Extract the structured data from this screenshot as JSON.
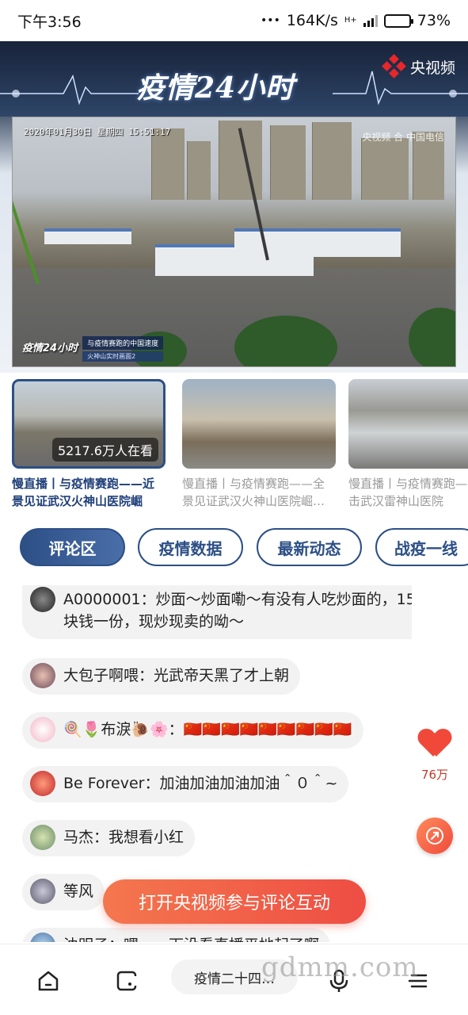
{
  "status": {
    "time": "下午3:56",
    "speed": "164K/s",
    "network": "H+",
    "battery": "73%"
  },
  "banner": {
    "show_title": "疫情24小时",
    "brand": "央视频"
  },
  "video": {
    "timestamp": "2020年01月30日 星期四 15:51:17",
    "watermark": "央视频 合 中国电信",
    "tag_logo": "疫情24小时",
    "tag_main": "与疫情赛跑的中国速度",
    "tag_sub": "火神山实时画面2"
  },
  "thumbnails": [
    {
      "caption": "慢直播丨与疫情赛跑——近景见证武汉火神山医院崛起…",
      "viewers": "5217.6万人在看",
      "active": true
    },
    {
      "caption": "慢直播丨与疫情赛跑——全景见证武汉火神山医院崛…",
      "active": false
    },
    {
      "caption": "慢直播丨与疫情赛跑——直击武汉雷神山医院",
      "active": false
    }
  ],
  "tabs": [
    "评论区",
    "疫情数据",
    "最新动态",
    "战疫一线"
  ],
  "comments": [
    {
      "text": "A0000001：炒面～炒面嘞～有没有人吃炒面的，15块钱一份，现炒现卖的呦～"
    },
    {
      "text": "大包子啊喂：光武帝天黑了才上朝"
    },
    {
      "text": "🍭🌷布淚🐌🌸：🇨🇳🇨🇳🇨🇳🇨🇳🇨🇳🇨🇳🇨🇳🇨🇳🇨🇳"
    },
    {
      "text": "Be Forever：加油加油加油加油＾０＾~"
    },
    {
      "text": "马杰：我想看小红"
    },
    {
      "text": "等风"
    },
    {
      "text": "浊明子：嘿，一下没看直播平地起了啊"
    }
  ],
  "like_count": "76万",
  "open_app_label": "打开央视频参与评论互动",
  "search_text": "疫情二十四…",
  "watermark": "gdmm.com",
  "colors": {
    "accent": "#2c4f86",
    "cta": "#ee4d43",
    "like": "#f0493a"
  },
  "icons": [
    "home-icon",
    "tabs-icon",
    "mic-icon",
    "menu-icon",
    "share-icon",
    "heart-icon"
  ]
}
